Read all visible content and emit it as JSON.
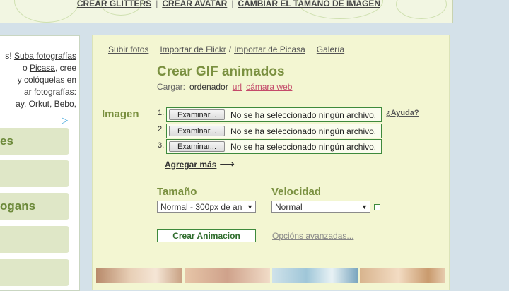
{
  "top_nav": [
    "CREAR GLITTERS",
    "CREAR AVATAR",
    "CAMBIAR EL TAMAÑO DE IMAGEN"
  ],
  "left": {
    "line1_pre": "s! ",
    "line1_link": "Suba fotografías",
    "line2_pre": "o ",
    "line2_link": "Picasa",
    "line2_post": ", cree",
    "line3": "y colóquelas en",
    "line4": "ar fotografías:",
    "line5": "ay, Orkut, Bebo,",
    "ad_icon": "adchoices-icon",
    "buttons": [
      "es",
      "",
      "ogans",
      "",
      ""
    ]
  },
  "upload_tabs": {
    "upload": "Subir fotos",
    "flickr": "Importar de Flickr",
    "slash": "/",
    "picasa": "Importar de Picasa",
    "gallery": "Galería"
  },
  "title": "Crear GIF animados",
  "source": {
    "label": "Cargar:",
    "computer": "ordenador",
    "url": "url",
    "webcam": "cámara web"
  },
  "image_section": {
    "label": "Imagen",
    "rows": [
      {
        "num": "1.",
        "button": "Examinar...",
        "status": "No se ha seleccionado ningún archivo."
      },
      {
        "num": "2.",
        "button": "Examinar...",
        "status": "No se ha seleccionado ningún archivo."
      },
      {
        "num": "3.",
        "button": "Examinar...",
        "status": "No se ha seleccionado ningún archivo."
      }
    ],
    "help": "¿Ayuda?",
    "add_more": "Agregar más",
    "add_more_arrow": "⟶"
  },
  "size": {
    "label": "Tamaño",
    "value": "Normal - 300px de an"
  },
  "speed": {
    "label": "Velocidad",
    "value": "Normal"
  },
  "create_button": "Crear Animacion",
  "advanced": "Opcións avanzadas...",
  "colors": {
    "accent_green": "#7a9040",
    "link_pink": "#c44a6a",
    "panel": "#f3f6d2",
    "border_green": "#3e8a3c"
  }
}
